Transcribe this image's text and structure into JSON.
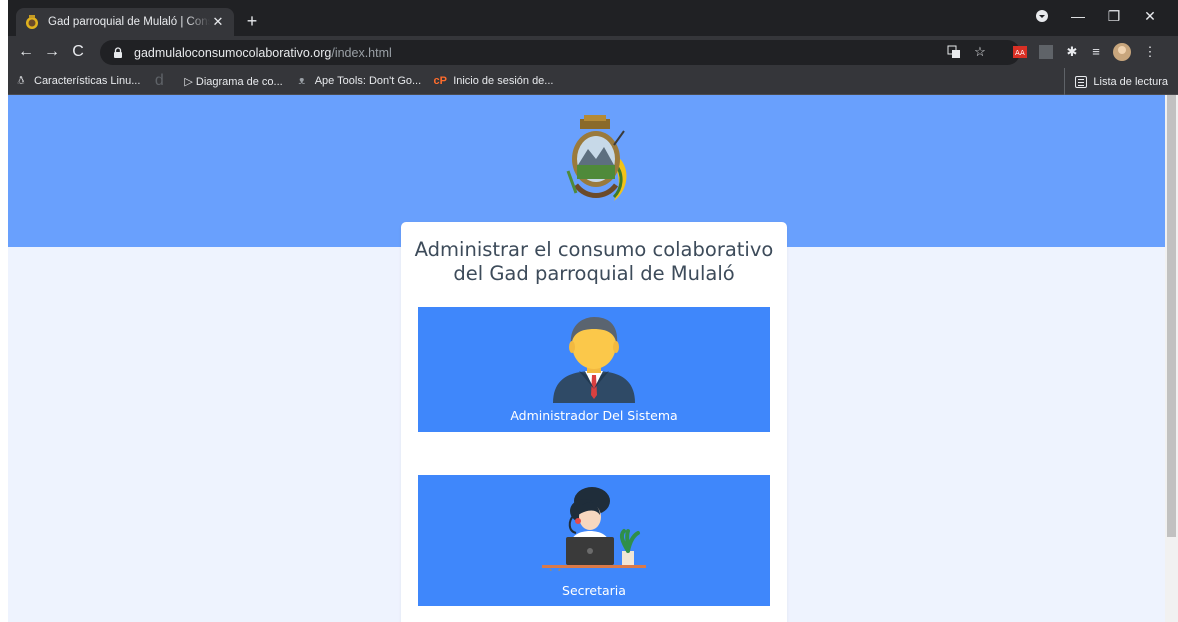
{
  "browser": {
    "tab_title": "Gad parroquial de Mulaló | Consumo colaborativo",
    "tab_close": "✕",
    "new_tab": "+",
    "url_host": "gadmulaloconsumocolaborativo.org",
    "url_path": "/index.html",
    "window_controls": {
      "minimize": "—",
      "restore": "❐",
      "close": "✕"
    },
    "bookmarks": [
      {
        "label": "Características Linu...",
        "icon": "penguin-icon"
      },
      {
        "label": "",
        "icon": "d-icon"
      },
      {
        "label": "▷ Diagrama de co...",
        "icon": ""
      },
      {
        "label": "Ape Tools: Don't Go...",
        "icon": "ape-icon"
      },
      {
        "label": "Inicio de sesión de...",
        "icon": "cp-icon"
      }
    ],
    "reading_list": "Lista de lectura"
  },
  "page": {
    "title_line1": "Administrar el consumo colaborativo",
    "title_line2": "del Gad parroquial de Mulaló",
    "roles": [
      {
        "label": "Administrador Del Sistema",
        "icon": "businessman-avatar-icon"
      },
      {
        "label": "Secretaria",
        "icon": "secretary-avatar-icon"
      }
    ]
  },
  "colors": {
    "hero": "#69a0fd",
    "button": "#3f87fb",
    "page_bg": "#eef3fe",
    "title_text": "#3d4b5a"
  }
}
